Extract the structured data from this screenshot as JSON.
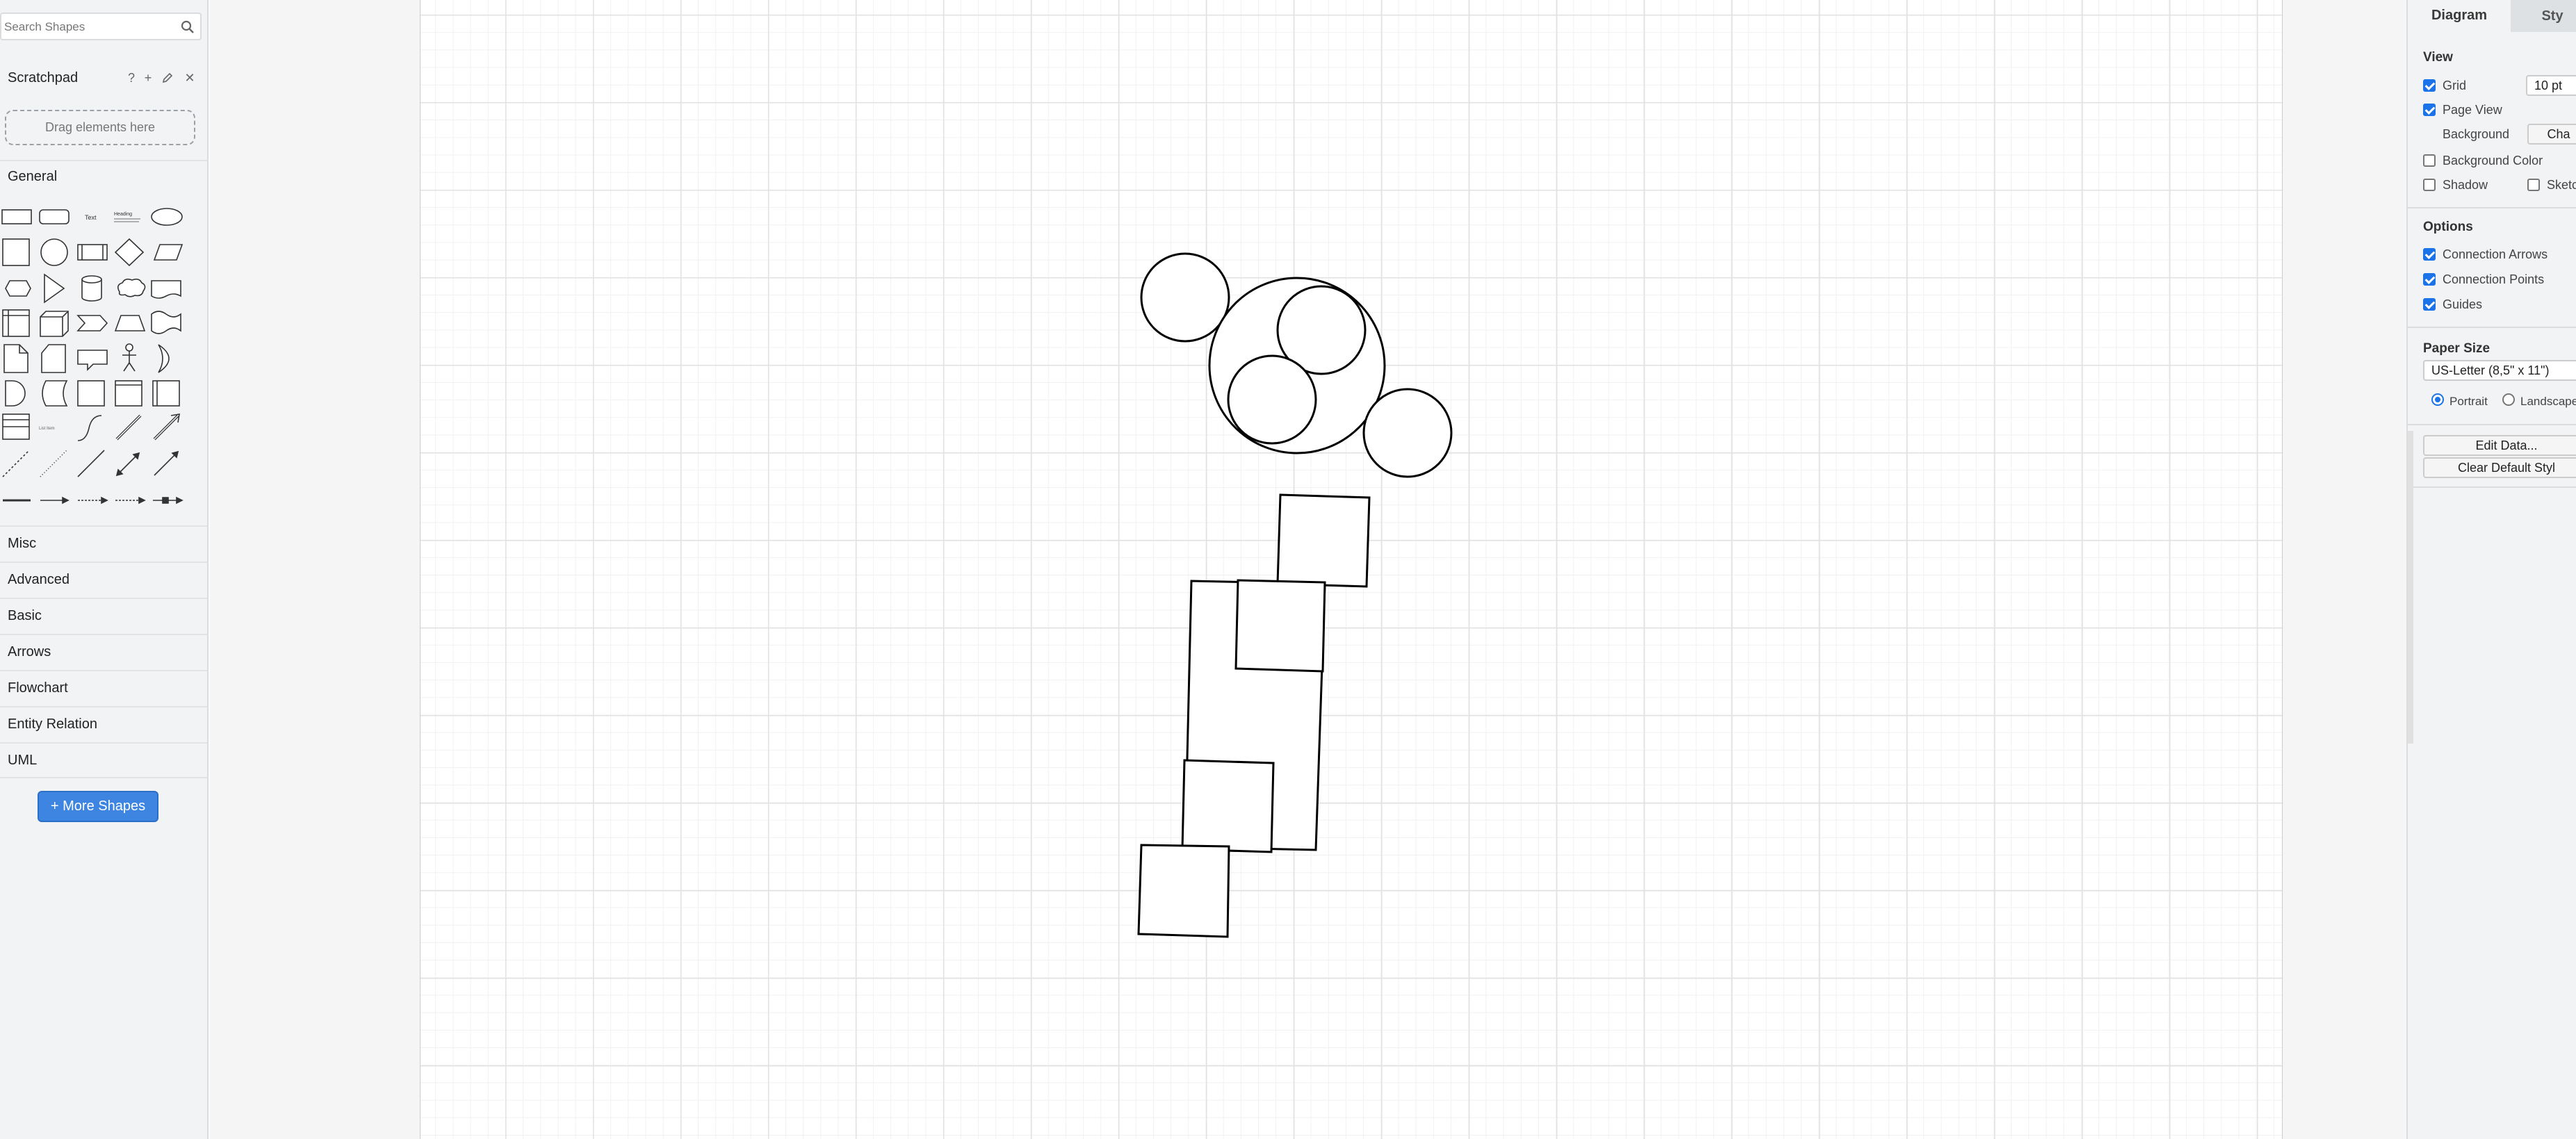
{
  "sidebar": {
    "search_placeholder": "Search Shapes",
    "scratchpad": {
      "title": "Scratchpad",
      "icons": [
        "help-icon",
        "add-icon",
        "edit-icon",
        "close-icon"
      ],
      "drop_hint": "Drag elements here"
    },
    "general_label": "General",
    "categories": [
      "Misc",
      "Advanced",
      "Basic",
      "Arrows",
      "Flowchart",
      "Entity Relation",
      "UML"
    ],
    "more_shapes_label": "+ More Shapes"
  },
  "format_panel": {
    "tabs": [
      "Diagram",
      "Sty"
    ],
    "view": {
      "title": "View",
      "grid_label": "Grid",
      "grid_checked": true,
      "grid_size": "10 pt",
      "page_view_label": "Page View",
      "page_view_checked": true,
      "background_label": "Background",
      "background_button": "Cha",
      "background_color_label": "Background Color",
      "background_color_checked": false,
      "shadow_label": "Shadow",
      "shadow_checked": false,
      "sketch_label": "Sketc",
      "sketch_checked": false
    },
    "options": {
      "title": "Options",
      "connection_arrows_label": "Connection Arrows",
      "connection_arrows_checked": true,
      "connection_points_label": "Connection Points",
      "connection_points_checked": true,
      "guides_label": "Guides",
      "guides_checked": true
    },
    "paper": {
      "title": "Paper Size",
      "size_value": "US-Letter (8,5\" x 11\")",
      "portrait_label": "Portrait",
      "landscape_label": "Landscape",
      "orientation": "portrait"
    },
    "edit_data_label": "Edit Data...",
    "clear_style_label": "Clear Default Styl"
  },
  "diagram": {
    "shape_count": 12,
    "stroke_color": "#000000",
    "fill_color": "#ffffff"
  }
}
